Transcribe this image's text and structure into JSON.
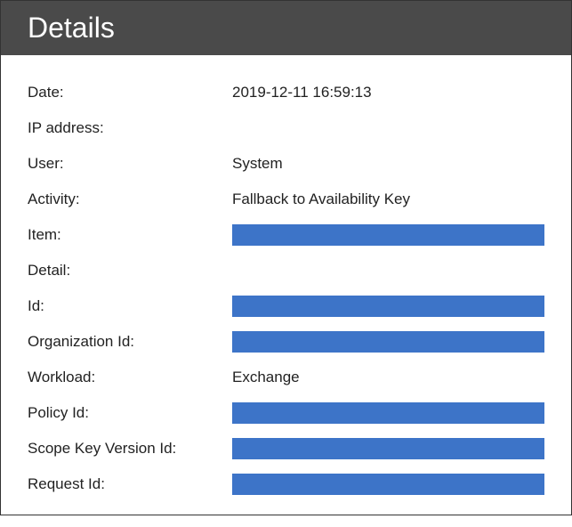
{
  "header": {
    "title": "Details"
  },
  "fields": {
    "date": {
      "label": "Date:",
      "value": "2019-12-11 16:59:13",
      "redacted": false
    },
    "ip": {
      "label": "IP address:",
      "value": "",
      "redacted": false
    },
    "user": {
      "label": "User:",
      "value": "System",
      "redacted": false
    },
    "activity": {
      "label": "Activity:",
      "value": "Fallback to Availability Key",
      "redacted": false
    },
    "item": {
      "label": "Item:",
      "value": "",
      "redacted": true
    },
    "detail": {
      "label": "Detail:",
      "value": "",
      "redacted": false
    },
    "id": {
      "label": "Id:",
      "value": "",
      "redacted": true
    },
    "org_id": {
      "label": "Organization Id:",
      "value": "",
      "redacted": true
    },
    "workload": {
      "label": "Workload:",
      "value": "Exchange",
      "redacted": false
    },
    "policy_id": {
      "label": "Policy Id:",
      "value": "",
      "redacted": true
    },
    "scope_key": {
      "label": "Scope Key Version Id:",
      "value": "",
      "redacted": true
    },
    "request_id": {
      "label": "Request Id:",
      "value": "",
      "redacted": true
    }
  },
  "colors": {
    "redacted": "#3d74c8",
    "header_bg": "#4a4a4a"
  }
}
